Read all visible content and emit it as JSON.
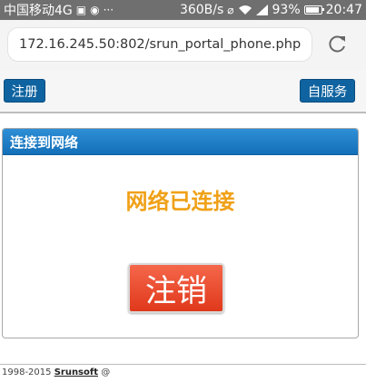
{
  "status_bar": {
    "carrier": "中国移动4G",
    "speed": "360B/s",
    "battery": "93%",
    "time": "20:47",
    "icons": [
      "image-icon",
      "location-icon",
      "more-icon",
      "vibrate-icon",
      "wifi-icon",
      "signal-icon",
      "battery-icon"
    ]
  },
  "browser": {
    "url": "172.16.245.50:802/srun_portal_phone.php",
    "reload_icon": "reload-icon"
  },
  "toolbar": {
    "register_label": "注册",
    "self_service_label": "自服务"
  },
  "panel": {
    "title": "连接到网络",
    "status": "网络已连接",
    "logout_label": "注销"
  },
  "footer": {
    "prefix": "1998-2015 ",
    "link": "Srunsoft",
    "suffix": " @"
  },
  "colors": {
    "accent_blue": "#0f63a0",
    "status_orange": "#f0a118",
    "logout_red": "#e0381b"
  }
}
